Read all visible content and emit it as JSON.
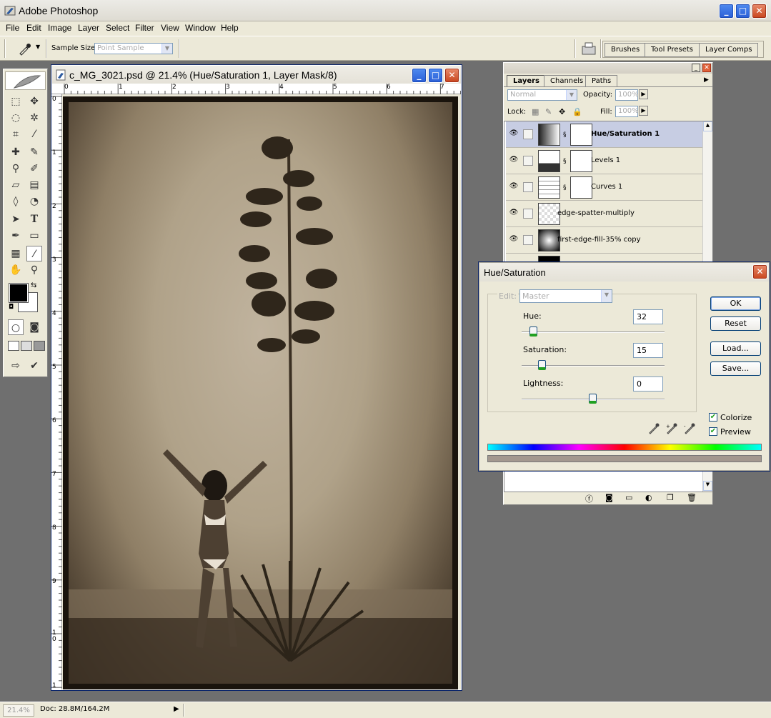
{
  "app": {
    "title": "Adobe Photoshop"
  },
  "menu": [
    "File",
    "Edit",
    "Image",
    "Layer",
    "Select",
    "Filter",
    "View",
    "Window",
    "Help"
  ],
  "options_bar": {
    "sample_size_label": "Sample Size:",
    "sample_size_value": "Point Sample",
    "tabs": [
      "Brushes",
      "Tool Presets",
      "Layer Comps"
    ]
  },
  "document": {
    "title": "c_MG_3021.psd @ 21.4% (Hue/Saturation 1, Layer Mask/8)",
    "ruler_h": [
      "0",
      "1",
      "2",
      "3",
      "4",
      "5",
      "6",
      "7"
    ],
    "ruler_v": [
      "0",
      "1",
      "2",
      "3",
      "4",
      "5",
      "6",
      "7",
      "8",
      "9",
      "1\n0",
      "1"
    ]
  },
  "layers_panel": {
    "tabs": [
      "Layers",
      "Channels",
      "Paths"
    ],
    "blend_mode": "Normal",
    "opacity_label": "Opacity:",
    "opacity_value": "100%",
    "lock_label": "Lock:",
    "fill_label": "Fill:",
    "fill_value": "100%",
    "layers": [
      {
        "name": "Hue/Saturation 1",
        "kind": "adjustment",
        "active": true
      },
      {
        "name": "Levels 1",
        "kind": "adjustment",
        "active": false
      },
      {
        "name": "Curves 1",
        "kind": "adjustment",
        "active": false
      },
      {
        "name": "edge-spatter-multiply",
        "kind": "pixel",
        "active": false
      },
      {
        "name": "first-edge-fill-35% copy",
        "kind": "pixel",
        "active": false
      }
    ]
  },
  "hue_saturation": {
    "title": "Hue/Saturation",
    "edit_label": "Edit:",
    "edit_value": "Master",
    "hue_label": "Hue:",
    "hue_value": "32",
    "saturation_label": "Saturation:",
    "saturation_value": "15",
    "lightness_label": "Lightness:",
    "lightness_value": "0",
    "buttons": {
      "ok": "OK",
      "reset": "Reset",
      "load": "Load...",
      "save": "Save..."
    },
    "colorize_label": "Colorize",
    "preview_label": "Preview",
    "colorize_checked": true,
    "preview_checked": true,
    "colorized_bar_color": "#a3988f"
  },
  "status_bar": {
    "zoom": "21.4%",
    "doc_info": "Doc: 28.8M/164.2M"
  }
}
